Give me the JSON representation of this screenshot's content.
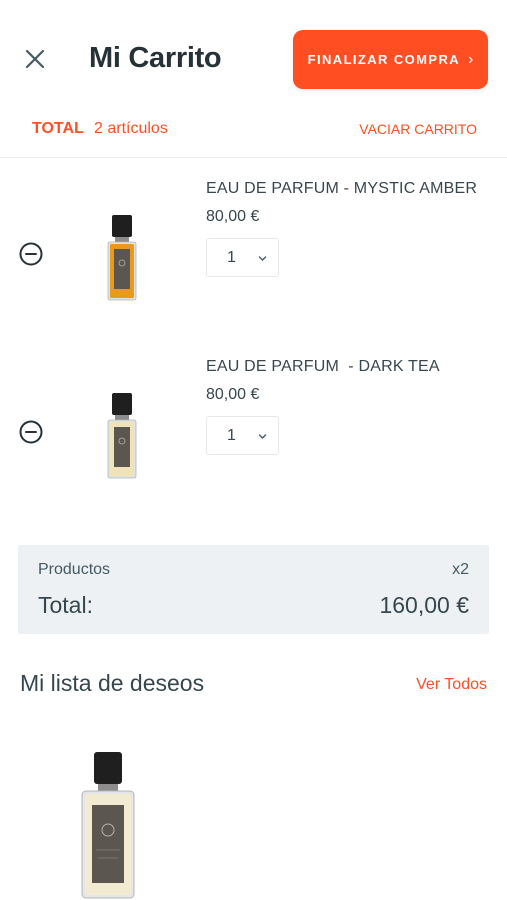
{
  "header": {
    "title": "Mi Carrito",
    "checkout_label": "FINALIZAR COMPRA",
    "checkout_chevron": "›"
  },
  "summary": {
    "total_label": "TOTAL",
    "item_count": "2 artículos",
    "empty_cart": "VACIAR CARRITO"
  },
  "cart_items": [
    {
      "name": "EAU DE PARFUM - MYSTIC AMBER",
      "price": "80,00 €",
      "quantity": "1",
      "liquid_color": "#e89a1e"
    },
    {
      "name": "EAU DE PARFUM  - DARK TEA",
      "price": "80,00 €",
      "quantity": "1",
      "liquid_color": "#f1e3b8"
    }
  ],
  "totals": {
    "products_label": "Productos",
    "products_qty": "x2",
    "total_label": "Total:",
    "total_value": "160,00 €"
  },
  "wishlist": {
    "title": "Mi lista de deseos",
    "see_all": "Ver Todos"
  },
  "colors": {
    "accent": "#ff4e22",
    "text": "#37474f",
    "panel": "#eef1f3"
  },
  "icons": [
    "close-icon",
    "remove-circle-icon",
    "chevron-down-icon",
    "chevron-right-icon"
  ]
}
